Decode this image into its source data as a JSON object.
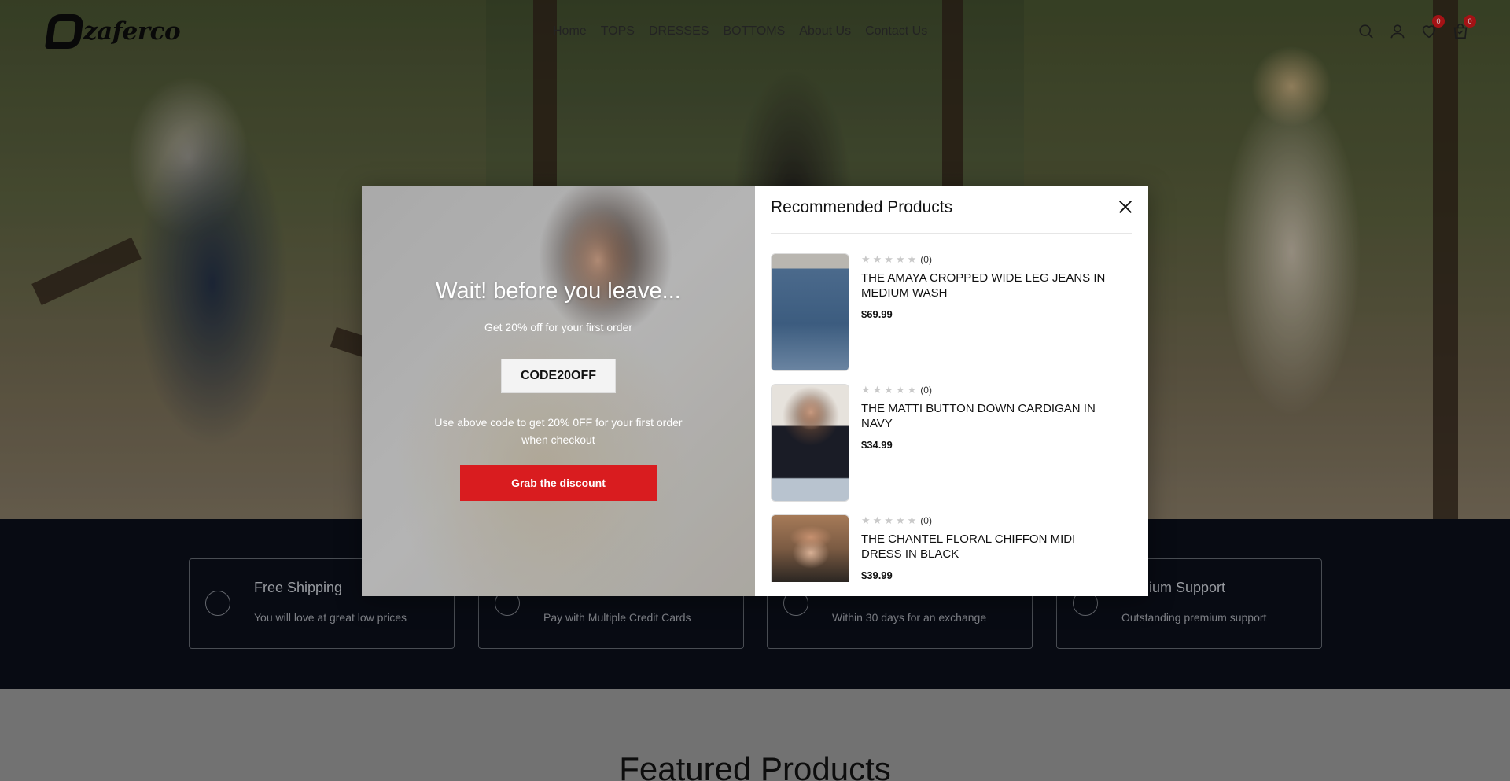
{
  "header": {
    "logo_text": "zaferco",
    "nav": [
      "Home",
      "TOPS",
      "DRESSES",
      "BOTTOMS",
      "About Us",
      "Contact Us"
    ],
    "wishlist_count": "0",
    "cart_count": "0"
  },
  "features": [
    {
      "title": "Free Shipping",
      "text": "You will love at great low prices"
    },
    {
      "title": "",
      "text": "Pay with Multiple Credit Cards"
    },
    {
      "title": "",
      "text": "Within 30 days for an exchange"
    },
    {
      "title": "mium Support",
      "text": "Outstanding premium support"
    }
  ],
  "featured": {
    "title": "Featured Products"
  },
  "popup": {
    "heading": "Wait! before you leave...",
    "subheading": "Get 20% off for your first order",
    "code": "CODE20OFF",
    "note": "Use above code to get 20% 0FF for your first order when checkout",
    "cta": "Grab the discount"
  },
  "recommended": {
    "title": "Recommended Products",
    "products": [
      {
        "stars": "★★★★★",
        "reviews": "(0)",
        "name": "THE AMAYA CROPPED WIDE LEG JEANS IN MEDIUM WASH",
        "price": "$69.99",
        "image": "jeans"
      },
      {
        "stars": "★★★★★",
        "reviews": "(0)",
        "name": "THE MATTI BUTTON DOWN CARDIGAN IN NAVY",
        "price": "$34.99",
        "image": "cardigan"
      },
      {
        "stars": "★★★★★",
        "reviews": "(0)",
        "name": "THE CHANTEL FLORAL CHIFFON MIDI DRESS IN BLACK",
        "price": "$39.99",
        "image": "dress"
      }
    ]
  },
  "colors": {
    "accent": "#d91c1f",
    "badge": "#c8161a",
    "band": "#0a0e18"
  },
  "icons": [
    "search-icon",
    "account-icon",
    "wishlist-icon",
    "cart-icon",
    "close-icon"
  ]
}
